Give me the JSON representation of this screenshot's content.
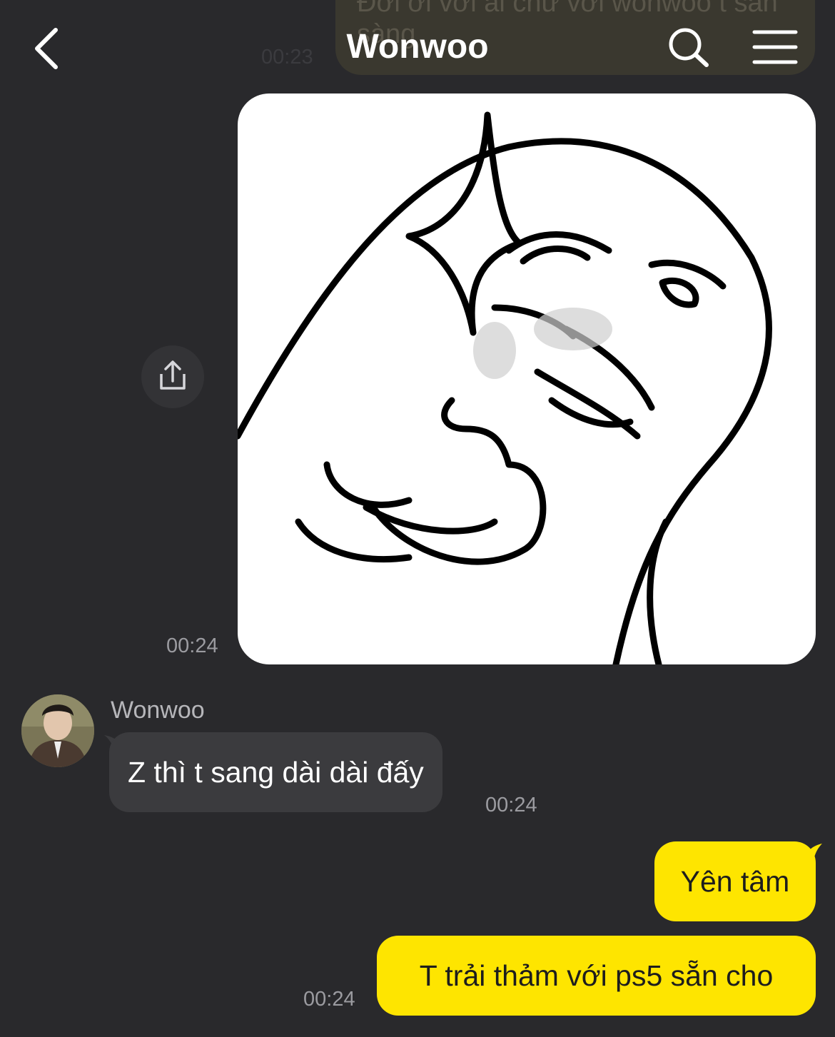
{
  "header": {
    "title": "Wonwoo",
    "back_icon": "chevron-left-icon",
    "search_icon": "search-icon",
    "menu_icon": "menu-icon"
  },
  "previous_message": {
    "text": "Đời ơi với ai chứ với wonwoo t sẵn sàng",
    "time": "00:23"
  },
  "messages": [
    {
      "type": "sticker",
      "direction": "outgoing",
      "sticker": "rage-face-thumbs-up",
      "time": "00:24"
    },
    {
      "type": "text",
      "direction": "incoming",
      "sender": "Wonwoo",
      "text": "Z thì t sang dài dài đấy",
      "time": "00:24"
    },
    {
      "type": "text",
      "direction": "outgoing",
      "text": "Yên tâm"
    },
    {
      "type": "text",
      "direction": "outgoing",
      "text": "T trải thảm với ps5 sẵn cho",
      "time": "00:24"
    }
  ],
  "share_icon": "share-icon",
  "colors": {
    "background": "#29292c",
    "outgoing_bubble": "#fee500",
    "incoming_bubble": "#3b3b3e",
    "timestamp": "#9b9ba0"
  }
}
